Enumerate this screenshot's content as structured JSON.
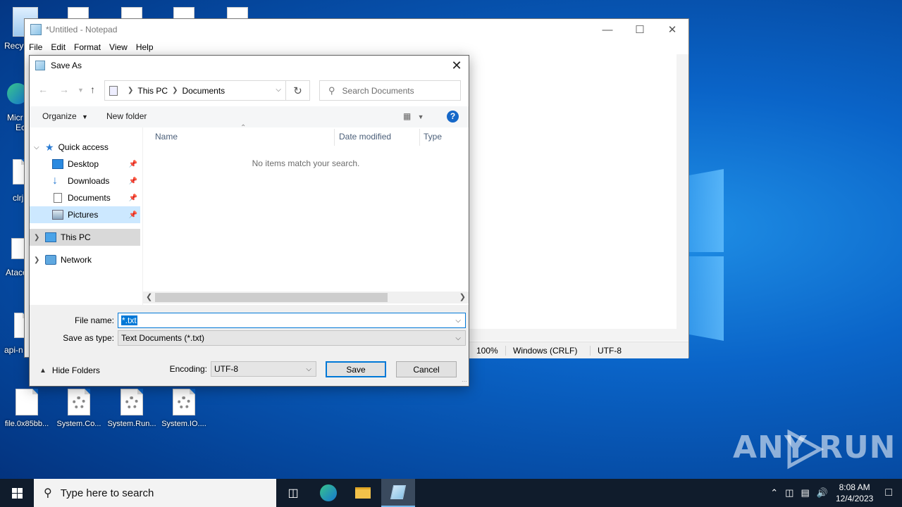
{
  "desktop": {
    "icons": [
      {
        "label": "file.0x85bb..."
      },
      {
        "label": "System.Co..."
      },
      {
        "label": "System.Run..."
      },
      {
        "label": "System.IO...."
      }
    ],
    "left_clipped": [
      "Recy",
      "Micr",
      "Ec",
      "clrj",
      "Atace",
      "api-n"
    ]
  },
  "watermark": {
    "text": "ANY RUN"
  },
  "notepad": {
    "title": "*Untitled - Notepad",
    "menu": [
      "File",
      "Edit",
      "Format",
      "View",
      "Help"
    ],
    "status": {
      "zoom": "100%",
      "line_endings": "Windows (CRLF)",
      "encoding": "UTF-8"
    }
  },
  "dialog": {
    "title": "Save As",
    "breadcrumb": [
      "This PC",
      "Documents"
    ],
    "search_placeholder": "Search Documents",
    "toolbar": {
      "organize": "Organize",
      "new_folder": "New folder"
    },
    "nav": {
      "quick_access": "Quick access",
      "items": [
        {
          "label": "Desktop"
        },
        {
          "label": "Downloads"
        },
        {
          "label": "Documents"
        },
        {
          "label": "Pictures"
        }
      ],
      "this_pc": "This PC",
      "network": "Network"
    },
    "columns": [
      "Name",
      "Date modified",
      "Type"
    ],
    "empty_message": "No items match your search.",
    "file_name_label": "File name:",
    "file_name_value": "*.txt",
    "save_type_label": "Save as type:",
    "save_type_value": "Text Documents (*.txt)",
    "hide_folders": "Hide Folders",
    "encoding_label": "Encoding:",
    "encoding_value": "UTF-8",
    "save_label": "Save",
    "cancel_label": "Cancel"
  },
  "taskbar": {
    "search_placeholder": "Type here to search",
    "time": "8:08 AM",
    "date": "12/4/2023"
  }
}
